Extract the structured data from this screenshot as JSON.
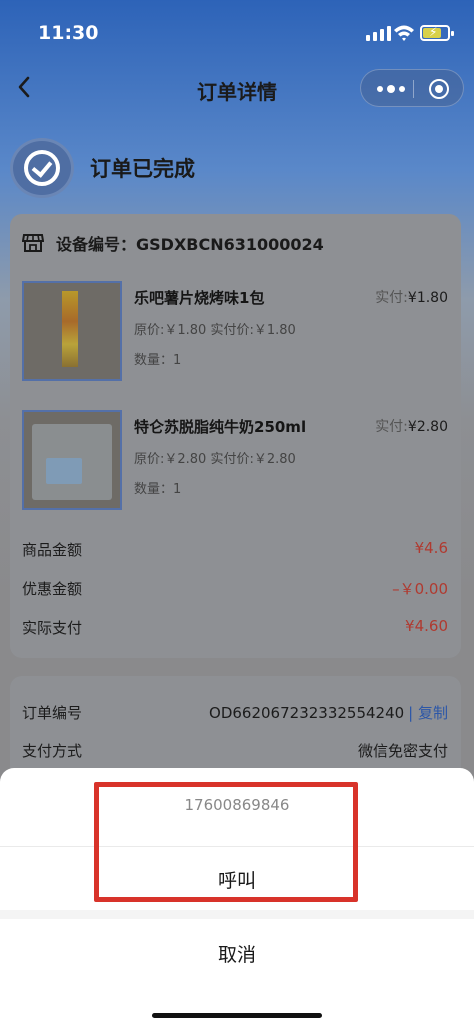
{
  "status_bar": {
    "time": "11:30"
  },
  "navbar": {
    "title": "订单详情",
    "back_icon": "chevron-left-icon",
    "menu_icon": "more-dots-icon",
    "close_icon": "target-icon"
  },
  "order_status": {
    "text": "订单已完成",
    "icon": "check-circle-icon"
  },
  "device": {
    "label": "设备编号：GSDXBCN631000024",
    "icon": "shop-icon"
  },
  "products": [
    {
      "name": "乐吧薯片烧烤味1包",
      "paid_label": "实付:",
      "paid": "¥1.80",
      "orig": "原价:￥1.80  实付价:￥1.80",
      "qty": "数量：1"
    },
    {
      "name": "特仑苏脱脂纯牛奶250ml",
      "paid_label": "实付:",
      "paid": "¥2.80",
      "orig": "原价:￥2.80  实付价:￥2.80",
      "qty": "数量：1"
    }
  ],
  "summary": {
    "goods_label": "商品金额",
    "goods_value": "¥4.6",
    "discount_label": "优惠金额",
    "discount_value": "–￥0.00",
    "paid_label": "实际支付",
    "paid_value": "¥4.60"
  },
  "info": {
    "order_label": "订单编号",
    "order_value": "OD662067232332554240",
    "copy_label": "| 复制",
    "pay_label": "支付方式",
    "pay_value": "微信免密支付"
  },
  "sheet": {
    "phone": "17600869846",
    "call": "呼叫",
    "cancel": "取消"
  },
  "colors": {
    "accent_red": "#b03a30",
    "link_blue": "#2b56a8",
    "highlight_red": "#d8332a"
  }
}
